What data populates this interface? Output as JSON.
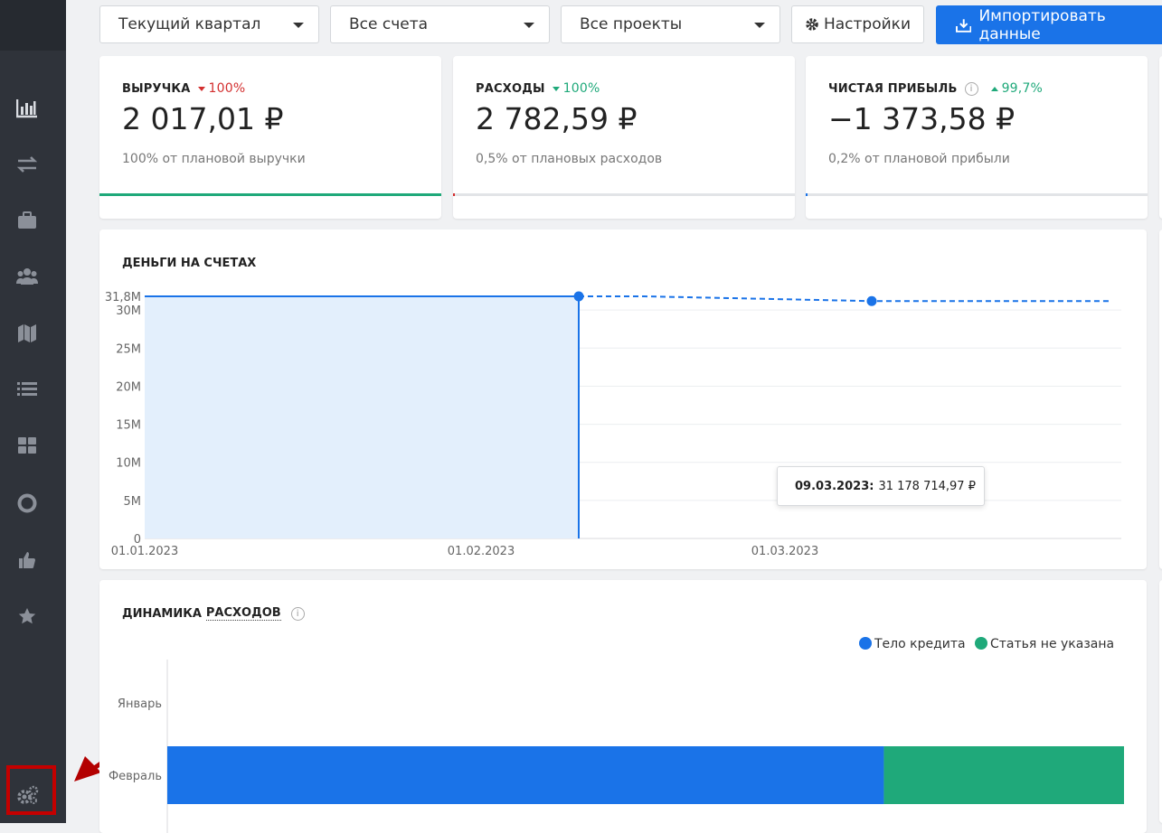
{
  "filters": {
    "period": "Текущий квартал",
    "accounts": "Все счета",
    "projects": "Все проекты"
  },
  "buttons": {
    "settings": "Настройки",
    "import": "Импортировать данные"
  },
  "kpis": [
    {
      "label": "ВЫРУЧКА",
      "delta": "100%",
      "delta_dir": "down",
      "delta_color": "#d32f2f",
      "value": "2 017,01 ₽",
      "sub": "100% от плановой выручки",
      "progress": 1.0,
      "bar_color": "#1fa97a"
    },
    {
      "label": "РАСХОДЫ",
      "delta": "100%",
      "delta_dir": "down",
      "delta_color": "#1fa97a",
      "value": "2 782,59 ₽",
      "sub": "0,5% от плановых расходов",
      "progress": 0.005,
      "bar_color": "#d32f2f"
    },
    {
      "label": "ЧИСТАЯ ПРИБЫЛЬ",
      "delta": "99,7%",
      "delta_dir": "up",
      "delta_color": "#1fa97a",
      "value": "−1 373,58 ₽",
      "sub": "0,2% от плановой прибыли",
      "progress": 0.002,
      "bar_color": "#1a73e8"
    }
  ],
  "balance_chart": {
    "title": "ДЕНЬГИ НА СЧЕТАХ",
    "tooltip_date": "09.03.2023:",
    "tooltip_value": "31 178 714,97 ₽"
  },
  "expense_chart": {
    "title_part1": "ДИНАМИКА",
    "title_part2": "РАСХОДОВ"
  },
  "chart_data": [
    {
      "type": "area",
      "title": "ДЕНЬГИ НА СЧЕТАХ",
      "y_ticks": [
        "0",
        "5M",
        "10M",
        "15M",
        "20M",
        "25M",
        "30M"
      ],
      "y_max_label": "31,8M",
      "x_ticks": [
        "01.01.2023",
        "01.02.2023",
        "01.03.2023"
      ],
      "ylim": [
        0,
        31800000
      ],
      "series": [
        {
          "values_actual": [
            31800000,
            31800000
          ],
          "x_actual": [
            "01.01.2023",
            "10.02.2023"
          ]
        },
        {
          "values_forecast": [
            31800000,
            31800000,
            31178714.97,
            31178714.97
          ],
          "x_forecast": [
            "10.02.2023",
            "16.02.2023",
            "09.03.2023",
            "31.03.2023"
          ]
        }
      ],
      "highlight_point": {
        "x": "09.03.2023",
        "y": 31178714.97
      }
    },
    {
      "type": "bar",
      "orientation": "horizontal",
      "stacked": true,
      "categories": [
        "Январь",
        "Февраль"
      ],
      "series": [
        {
          "name": "Тело кредита",
          "color": "#1a73e8",
          "values": [
            0,
            0.749
          ]
        },
        {
          "name": "Статья не указана",
          "color": "#1fa97a",
          "values": [
            0,
            0.251
          ]
        }
      ]
    }
  ]
}
